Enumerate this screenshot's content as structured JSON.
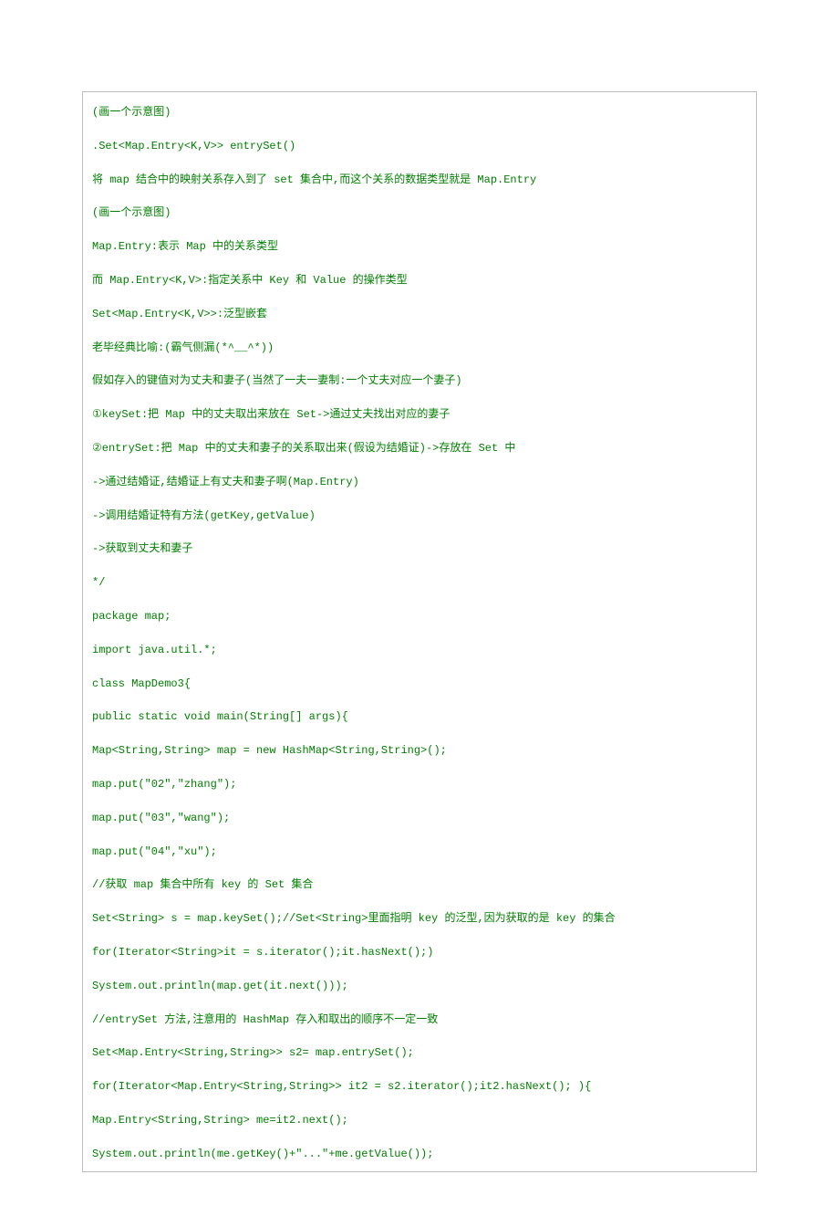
{
  "lines": [
    "(画一个示意图)",
    ".Set<Map.Entry<K,V>> entrySet()",
    "将 map 结合中的映射关系存入到了 set 集合中,而这个关系的数据类型就是 Map.Entry",
    "(画一个示意图)",
    "Map.Entry:表示 Map 中的关系类型",
    "而 Map.Entry<K,V>:指定关系中 Key 和 Value 的操作类型",
    "Set<Map.Entry<K,V>>:泛型嵌套",
    "老毕经典比喻:(霸气侧漏(*^__^*))",
    "假如存入的键值对为丈夫和妻子(当然了一夫一妻制:一个丈夫对应一个妻子)",
    "①keySet:把 Map 中的丈夫取出来放在 Set->通过丈夫找出对应的妻子",
    "②entrySet:把 Map 中的丈夫和妻子的关系取出来(假设为结婚证)->存放在 Set 中",
    "->通过结婚证,结婚证上有丈夫和妻子啊(Map.Entry)",
    "->调用结婚证特有方法(getKey,getValue)",
    "->获取到丈夫和妻子",
    "*/",
    "package map;",
    "import java.util.*;",
    "class MapDemo3{",
    "public static void main(String[] args){",
    "Map<String,String> map = new HashMap<String,String>();",
    "map.put(\"02\",\"zhang\");",
    "map.put(\"03\",\"wang\");",
    "map.put(\"04\",\"xu\");",
    "//获取 map 集合中所有 key 的 Set 集合",
    "Set<String> s = map.keySet();//Set<String>里面指明 key 的泛型,因为获取的是 key 的集合",
    "for(Iterator<String>it = s.iterator();it.hasNext();)",
    "System.out.println(map.get(it.next()));",
    "//entrySet 方法,注意用的 HashMap 存入和取出的顺序不一定一致",
    "Set<Map.Entry<String,String>> s2= map.entrySet();",
    "for(Iterator<Map.Entry<String,String>> it2 = s2.iterator();it2.hasNext(); ){",
    "Map.Entry<String,String> me=it2.next();",
    "System.out.println(me.getKey()+\"...\"+me.getValue());"
  ]
}
